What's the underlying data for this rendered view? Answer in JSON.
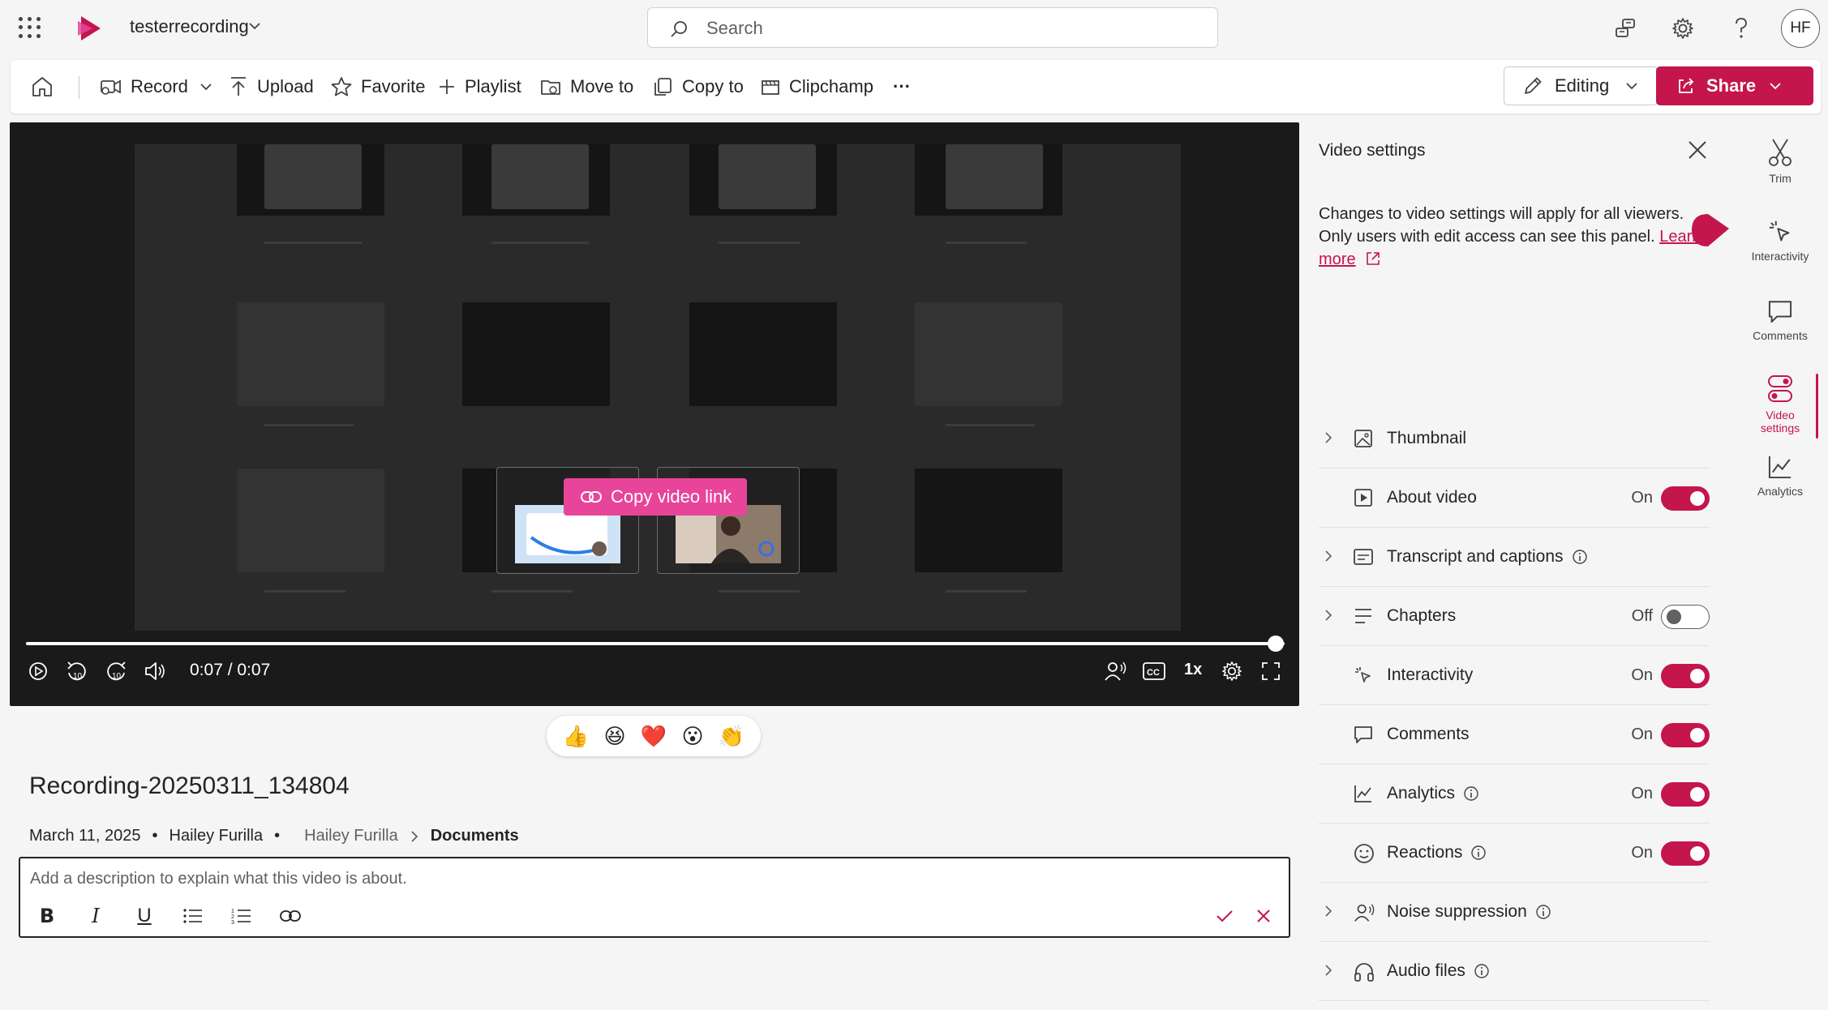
{
  "topbar": {
    "app_name": "testerrecording",
    "search_placeholder": "Search",
    "avatar_initials": "HF",
    "icons": [
      "waffle-icon",
      "stream-logo-icon",
      "chevron-down-icon",
      "search-icon",
      "share-feedback-icon",
      "gear-icon",
      "help-icon"
    ]
  },
  "command_bar": {
    "record": "Record",
    "upload": "Upload",
    "favorite": "Favorite",
    "playlist": "Playlist",
    "move_to": "Move to",
    "copy_to": "Copy to",
    "clipchamp": "Clipchamp",
    "more": "···",
    "editing": "Editing",
    "share": "Share"
  },
  "player": {
    "copy_video_link": "Copy video link",
    "time": "0:07 / 0:07",
    "speed": "1x",
    "progress": 1.0
  },
  "reactions": [
    "👍",
    "😆",
    "❤️",
    "😮",
    "👏"
  ],
  "video": {
    "title": "Recording-20250311_134804",
    "date": "March 11, 2025",
    "owner": "Hailey Furilla",
    "location_owner": "Hailey Furilla",
    "location_folder": "Documents",
    "description_placeholder": "Add a description to explain what this video is about."
  },
  "settings": {
    "title": "Video settings",
    "description": "Changes to video settings will apply for all viewers. Only users with edit access can see this panel. ",
    "learn_more": "Learn more",
    "rows": [
      {
        "label": "Thumbnail",
        "state": "",
        "expandable": true
      },
      {
        "label": "About video",
        "state": "On",
        "expandable": false
      },
      {
        "label": "Transcript and captions",
        "state": "",
        "expandable": true
      },
      {
        "label": "Chapters",
        "state": "Off",
        "expandable": true
      },
      {
        "label": "Interactivity",
        "state": "On",
        "expandable": false
      },
      {
        "label": "Comments",
        "state": "On",
        "expandable": false
      },
      {
        "label": "Analytics",
        "state": "On",
        "expandable": false
      },
      {
        "label": "Reactions",
        "state": "On",
        "expandable": false
      },
      {
        "label": "Noise suppression",
        "state": "",
        "expandable": true
      },
      {
        "label": "Audio files",
        "state": "",
        "expandable": true
      }
    ]
  },
  "rail": {
    "trim": "Trim",
    "interactivity": "Interactivity",
    "comments": "Comments",
    "video_settings": "Video settings",
    "analytics": "Analytics"
  },
  "colors": {
    "accent": "#c4154c",
    "link_button": "#e8449a",
    "background": "#f5f5f5"
  }
}
